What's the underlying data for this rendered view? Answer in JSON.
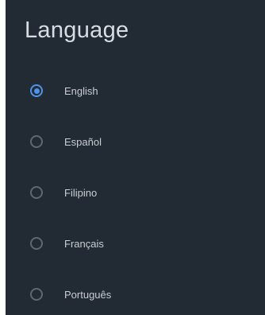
{
  "dialog": {
    "title": "Language",
    "options": [
      {
        "label": "English",
        "selected": true
      },
      {
        "label": "Español",
        "selected": false
      },
      {
        "label": "Filipino",
        "selected": false
      },
      {
        "label": "Français",
        "selected": false
      },
      {
        "label": "Português",
        "selected": false
      }
    ]
  },
  "colors": {
    "background": "#222a33",
    "accent": "#4f93e8",
    "text": "#c9ced4",
    "radio_unselected": "#5f6871"
  },
  "icons": {
    "selected": "radio-checked-icon",
    "unselected": "radio-unchecked-icon"
  }
}
